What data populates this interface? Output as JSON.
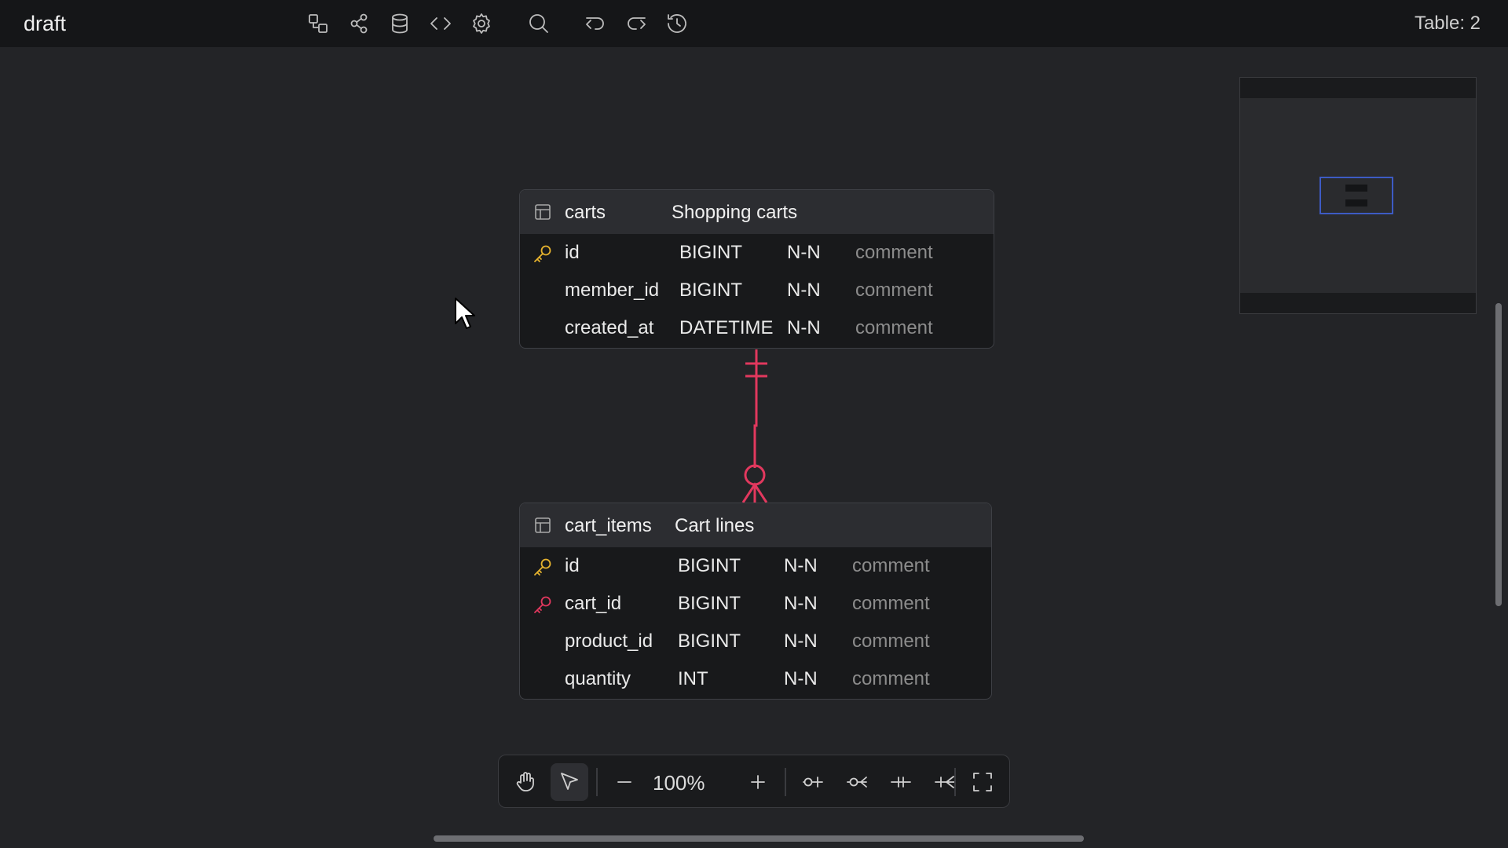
{
  "header": {
    "title": "draft",
    "table_count": "Table: 2",
    "tools": [
      {
        "name": "visualization-icon"
      },
      {
        "name": "share-icon"
      },
      {
        "name": "database-icon"
      },
      {
        "name": "code-icon"
      },
      {
        "name": "settings-gear-icon"
      },
      {
        "name": "search-icon"
      },
      {
        "name": "undo-icon"
      },
      {
        "name": "redo-icon"
      },
      {
        "name": "history-icon"
      }
    ]
  },
  "tables": [
    {
      "name": "carts",
      "comment": "Shopping carts",
      "columns": [
        {
          "name": "id",
          "type": "BIGINT",
          "nullable": "N-N",
          "comment": "comment",
          "key": "primary"
        },
        {
          "name": "member_id",
          "type": "BIGINT",
          "nullable": "N-N",
          "comment": "comment",
          "key": ""
        },
        {
          "name": "created_at",
          "type": "DATETIME",
          "nullable": "N-N",
          "comment": "comment",
          "key": ""
        }
      ]
    },
    {
      "name": "cart_items",
      "comment": "Cart lines",
      "columns": [
        {
          "name": "id",
          "type": "BIGINT",
          "nullable": "N-N",
          "comment": "comment",
          "key": "primary"
        },
        {
          "name": "cart_id",
          "type": "BIGINT",
          "nullable": "N-N",
          "comment": "comment",
          "key": "foreign"
        },
        {
          "name": "product_id",
          "type": "BIGINT",
          "nullable": "N-N",
          "comment": "comment",
          "key": ""
        },
        {
          "name": "quantity",
          "type": "INT",
          "nullable": "N-N",
          "comment": "comment",
          "key": ""
        }
      ]
    }
  ],
  "relation": {
    "from": "carts",
    "to": "cart_items",
    "color": "#e2385e"
  },
  "colors": {
    "primary_key": "#e6b32e",
    "foreign_key": "#e2385e",
    "minimap_viewport": "#3d5bc4"
  },
  "bottom_toolbar": {
    "zoom": "100%",
    "tools": [
      "hand-pan-icon",
      "select-pointer-icon",
      "zoom-out-icon",
      "zoom-in-icon",
      "relation-zero-one-icon",
      "relation-zero-many-icon",
      "relation-one-one-icon",
      "relation-one-many-icon",
      "fullscreen-icon"
    ]
  }
}
